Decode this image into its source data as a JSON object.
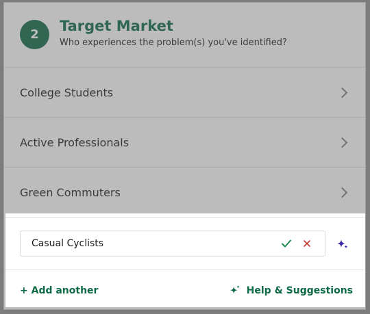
{
  "header": {
    "step_number": "2",
    "title": "Target Market",
    "subtitle": "Who experiences the problem(s) you've identified?"
  },
  "list": {
    "items": [
      {
        "label": "College Students"
      },
      {
        "label": "Active Professionals"
      },
      {
        "label": "Green Commuters"
      }
    ]
  },
  "editor": {
    "value": "Casual Cyclists",
    "confirm_icon": "check-icon",
    "cancel_icon": "close-icon",
    "suggest_icon": "sparkle-icon"
  },
  "footer": {
    "add_label": "+ Add another",
    "help_label": "Help & Suggestions",
    "help_icon": "sparkle-icon"
  },
  "colors": {
    "brand_green": "#0c6a45",
    "confirm_green": "#1f8a4c",
    "cancel_red": "#c0392b",
    "sparkle_purple": "#3b2aa8"
  }
}
